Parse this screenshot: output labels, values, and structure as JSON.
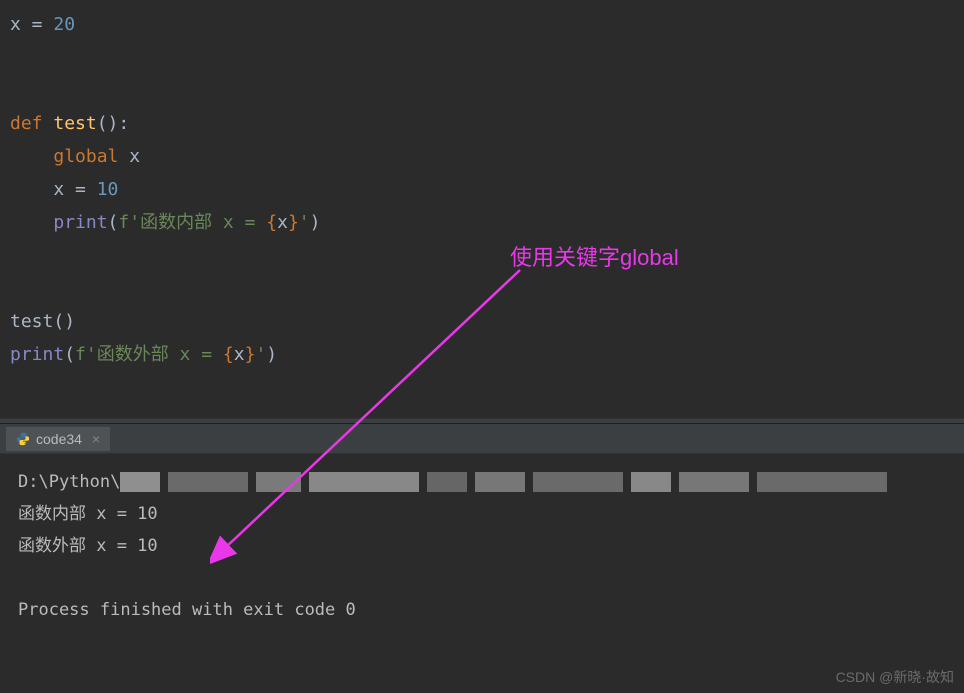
{
  "code": {
    "line1_var": "x",
    "line1_eq": " = ",
    "line1_val": "20",
    "line4_def": "def ",
    "line4_name": "test",
    "line4_paren": "()",
    "line4_colon": ":",
    "line5_indent": "    ",
    "line5_global": "global ",
    "line5_var": "x",
    "line6_indent": "    ",
    "line6_var": "x",
    "line6_eq": " = ",
    "line6_val": "10",
    "line7_indent": "    ",
    "line7_print": "print",
    "line7_open": "(",
    "line7_fprefix": "f'",
    "line7_str1": "函数内部 x = ",
    "line7_brace_open": "{",
    "line7_expr": "x",
    "line7_brace_close": "}",
    "line7_str2": "'",
    "line7_close": ")",
    "line10_call": "test",
    "line10_paren": "()",
    "line11_print": "print",
    "line11_open": "(",
    "line11_fprefix": "f'",
    "line11_str1": "函数外部 x = ",
    "line11_brace_open": "{",
    "line11_expr": "x",
    "line11_brace_close": "}",
    "line11_str2": "'",
    "line11_close": ")"
  },
  "annotation": {
    "text": "使用关键字global"
  },
  "tab": {
    "name": "code34",
    "close": "×"
  },
  "terminal": {
    "path_prefix": "D:\\Python\\",
    "line2": "函数内部 x = 10",
    "line3": "函数外部 x = 10",
    "line5": "Process finished with exit code 0"
  },
  "watermark": "CSDN @新晓·故知"
}
